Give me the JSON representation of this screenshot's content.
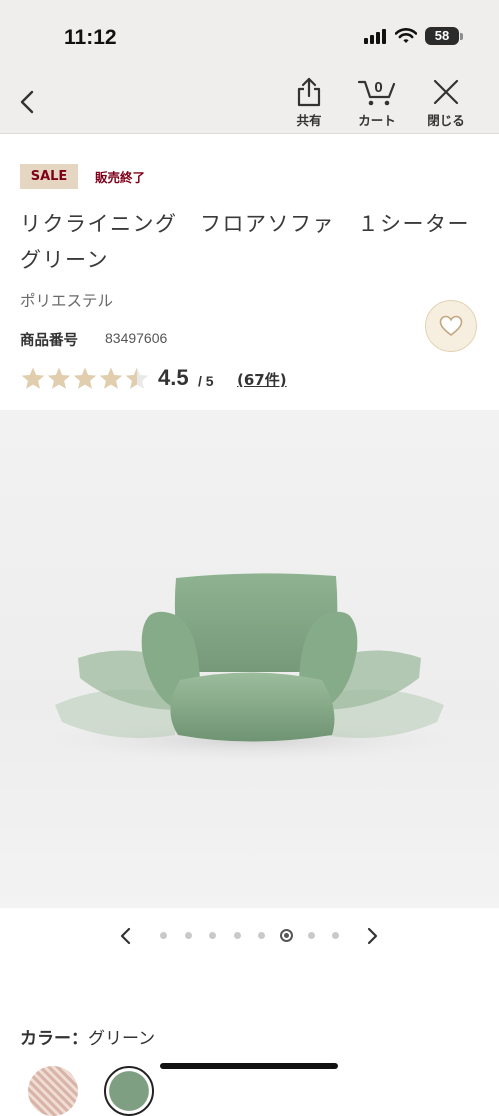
{
  "status_bar": {
    "time": "11:12",
    "battery": "58"
  },
  "nav": {
    "back_icon": "chevron-left-icon",
    "share": {
      "label": "共有",
      "icon": "share-icon"
    },
    "cart": {
      "label": "カート",
      "count": "0",
      "icon": "cart-icon"
    },
    "close": {
      "label": "閉じる",
      "icon": "close-icon"
    }
  },
  "product": {
    "badge": "SALE",
    "sale_status": "販売終了",
    "title": "リクライニング　フロアソファ　１シーター　グリーン",
    "material": "ポリエステル",
    "code_label": "商品番号",
    "code": "83497606",
    "rating": {
      "stars": 4.5,
      "value": "4.5",
      "max": "/ 5",
      "reviews": "(67件)"
    }
  },
  "carousel": {
    "total": 8,
    "active_index": 5
  },
  "color": {
    "label": "カラー：",
    "value": "グリーン"
  },
  "colors": {
    "star_filled": "#e0ceae",
    "star_empty": "#e9e9e9",
    "accent_dark_red": "#7f0019",
    "sale_bg": "#e4d6c1",
    "sofa_green": "#8aae8c"
  }
}
